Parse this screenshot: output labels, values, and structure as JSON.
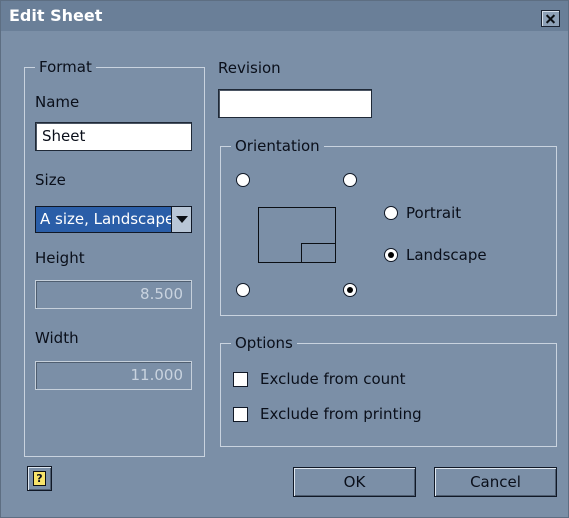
{
  "window": {
    "title": "Edit Sheet"
  },
  "format": {
    "legend": "Format",
    "name_label": "Name",
    "name_value": "Sheet",
    "size_label": "Size",
    "size_value": "A size, Landscape",
    "height_label": "Height",
    "height_value": "8.500",
    "width_label": "Width",
    "width_value": "11.000"
  },
  "revision": {
    "label": "Revision",
    "value": ""
  },
  "orientation": {
    "legend": "Orientation",
    "portrait_label": "Portrait",
    "landscape_label": "Landscape",
    "selected_orientation": "Landscape",
    "selected_corner": "bottom-right"
  },
  "options": {
    "legend": "Options",
    "exclude_count_label": "Exclude from count",
    "exclude_printing_label": "Exclude from printing",
    "exclude_count_checked": false,
    "exclude_printing_checked": false
  },
  "buttons": {
    "ok": "OK",
    "cancel": "Cancel"
  },
  "icons": {
    "close": "close-icon",
    "help": "help-icon",
    "dropdown": "chevron-down-icon"
  },
  "colors": {
    "background": "#7b8fa7",
    "titlebar": "#6a7f98",
    "selection": "#2a5ea8"
  }
}
